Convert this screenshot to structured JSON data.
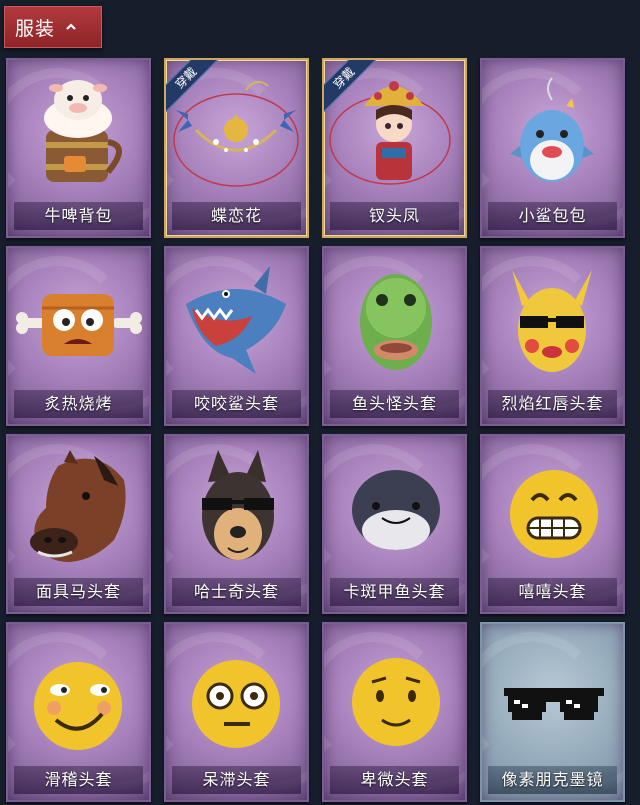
{
  "header": {
    "title": "服装",
    "icon": "chevron-up-icon"
  },
  "items": [
    {
      "label": "牛啤背包",
      "icon": "beer-barrel-cow-icon",
      "tag": ""
    },
    {
      "label": "蝶恋花",
      "icon": "butterfly-bell-necklace-icon",
      "tag": "穿戴"
    },
    {
      "label": "钗头凤",
      "icon": "phoenix-crown-doll-icon",
      "tag": "穿戴"
    },
    {
      "label": "小鲨包包",
      "icon": "shark-bag-icon",
      "tag": ""
    },
    {
      "label": "炙热烧烤",
      "icon": "grilled-meat-icon",
      "tag": ""
    },
    {
      "label": "咬咬鲨头套",
      "icon": "shark-head-icon",
      "tag": ""
    },
    {
      "label": "鱼头怪头套",
      "icon": "fish-head-mask-icon",
      "tag": ""
    },
    {
      "label": "烈焰红唇头套",
      "icon": "yellow-mask-sunglasses-icon",
      "tag": ""
    },
    {
      "label": "面具马头套",
      "icon": "horse-mask-icon",
      "tag": ""
    },
    {
      "label": "哈士奇头套",
      "icon": "husky-head-icon",
      "tag": ""
    },
    {
      "label": "卡斑甲鱼头套",
      "icon": "fish-head-round-icon",
      "tag": ""
    },
    {
      "label": "嘻嘻头套",
      "icon": "grin-emoji-icon",
      "tag": ""
    },
    {
      "label": "滑稽头套",
      "icon": "sly-emoji-icon",
      "tag": ""
    },
    {
      "label": "呆滞头套",
      "icon": "stunned-emoji-icon",
      "tag": ""
    },
    {
      "label": "卑微头套",
      "icon": "timid-emoji-icon",
      "tag": ""
    },
    {
      "label": "像素朋克墨镜",
      "icon": "pixel-sunglasses-icon",
      "tag": ""
    }
  ]
}
